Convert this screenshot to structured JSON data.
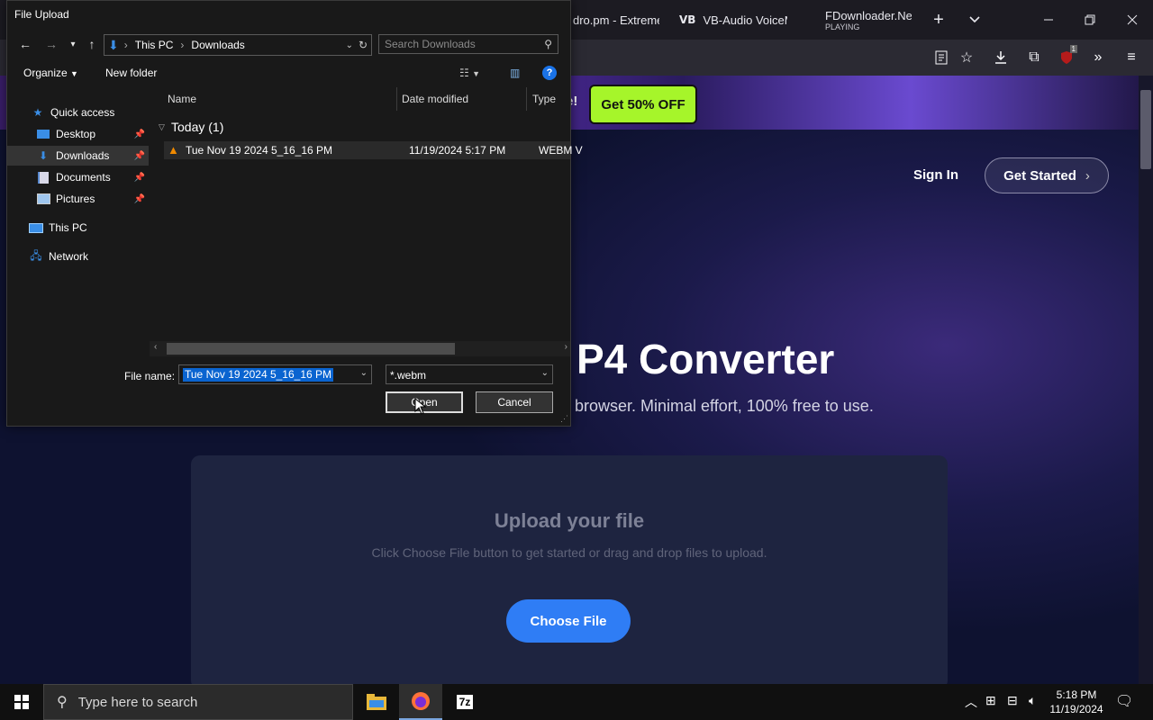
{
  "browser": {
    "tabs": [
      {
        "label": "dro.pm - Extreme"
      },
      {
        "logo": "VB",
        "label": "VB-Audio VoiceM"
      },
      {
        "label": "FDownloader.Net",
        "status": "PLAYING"
      }
    ],
    "new_tab_icon": "plus-icon",
    "tab_list_icon": "chevron-down-icon",
    "extension_badge": "1"
  },
  "webpage": {
    "promo_excl": "e!",
    "promo_button": "Get 50% OFF",
    "sign_in": "Sign In",
    "get_started": "Get Started",
    "hero_title": "P4 Converter",
    "hero_subtitle": "browser. Minimal effort, 100% free to use.",
    "upload_title": "Upload your file",
    "upload_hint": "Click Choose File button to get started or drag and drop files to upload.",
    "choose_file": "Choose File"
  },
  "dialog": {
    "title": "File Upload",
    "address": [
      "This PC",
      "Downloads"
    ],
    "search_placeholder": "Search Downloads",
    "organize": "Organize",
    "new_folder": "New folder",
    "nav": {
      "quick_access": "Quick access",
      "desktop": "Desktop",
      "downloads": "Downloads",
      "documents": "Documents",
      "pictures": "Pictures",
      "this_pc": "This PC",
      "network": "Network"
    },
    "columns": {
      "name": "Name",
      "date": "Date modified",
      "type": "Type"
    },
    "group": "Today (1)",
    "file": {
      "name": "Tue Nov 19 2024 5_16_16 PM",
      "date": "11/19/2024 5:17 PM",
      "type": "WEBM V"
    },
    "file_name_label": "File name:",
    "file_name_value": "Tue Nov 19 2024 5_16_16 PM",
    "filter": "*.webm",
    "open": "Open",
    "cancel": "Cancel"
  },
  "taskbar": {
    "search_placeholder": "Type here to search",
    "time": "5:18 PM",
    "date": "11/19/2024"
  }
}
